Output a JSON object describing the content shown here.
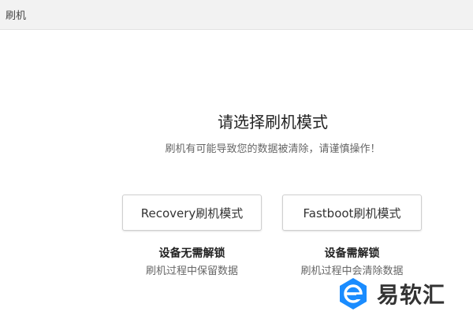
{
  "window": {
    "title": "刷机"
  },
  "main": {
    "heading": "请选择刷机模式",
    "subheading": "刷机有可能导致您的数据被清除，请谨慎操作！"
  },
  "modes": [
    {
      "button_label": "Recovery刷机模式",
      "title": "设备无需解锁",
      "description": "刷机过程中保留数据"
    },
    {
      "button_label": "Fastboot刷机模式",
      "title": "设备需解锁",
      "description": "刷机过程中会清除数据"
    }
  ],
  "watermark": {
    "text": "易软汇",
    "logo_icon": "e-logo-icon",
    "logo_color": "#1a8cff"
  }
}
